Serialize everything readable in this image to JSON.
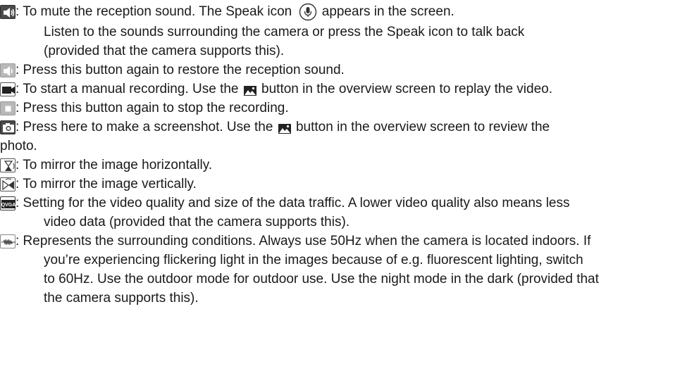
{
  "entries": [
    {
      "icon": "mute-speaker-icon",
      "line1_before": ": To mute the reception sound.  The Speak icon ",
      "inline_icon": "microphone-icon",
      "line1_after": " appears in the screen.",
      "line2": "Listen to the sounds surrounding the camera or press the Speak icon to talk back",
      "line3": "(provided that the camera supports this)."
    },
    {
      "icon": "speaker-icon",
      "text": ": Press this button again to restore the reception sound."
    },
    {
      "icon": "video-camera-icon",
      "before": ": To start a manual recording. Use the ",
      "inline_icon": "gallery-icon",
      "after": " button in the overview screen to replay the video."
    },
    {
      "icon": "stop-icon",
      "text": ": Press this button again to stop the recording."
    },
    {
      "icon": "camera-icon",
      "before": ": Press here to make a screenshot. Use the ",
      "inline_icon": "gallery-icon",
      "after": " button in the overview screen to review the",
      "wrap": "photo."
    },
    {
      "icon": "mirror-horizontal-icon",
      "text": ": To mirror the image horizontally."
    },
    {
      "icon": "mirror-vertical-icon",
      "text": ": To mirror the image vertically."
    },
    {
      "icon": "qvga-icon",
      "icon_label": "QVGA",
      "line1": ": Setting for the video quality and size of the data traffic. A lower video quality also means less",
      "line2": "video data (provided that the camera supports this)."
    },
    {
      "icon": "frequency-wave-icon",
      "line1": ": Represents the surrounding conditions. Always use 50Hz when the camera is located indoors. If",
      "line2": "you’re experiencing flickering light in the images because of e.g. fluorescent lighting, switch",
      "line3": "to 60Hz. Use the outdoor mode for outdoor use. Use the night mode in the dark (provided that",
      "line4": "the camera supports this)."
    }
  ]
}
